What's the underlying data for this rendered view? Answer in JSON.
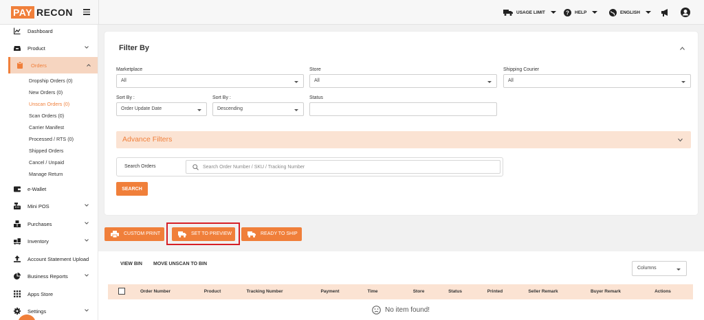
{
  "brand": {
    "part1": "PAY",
    "part2": "RECON",
    "accent": "#f07f3a"
  },
  "topbar": {
    "usage_limit": "USAGE LIMIT",
    "help": "HELP",
    "language": "ENGLISH",
    "icons": [
      "truck-icon",
      "help-circle-icon",
      "globe-icon",
      "megaphone-icon",
      "user-circle-icon"
    ]
  },
  "sidebar": {
    "items": [
      {
        "label": "Dashboard",
        "icon": "chart-line-icon"
      },
      {
        "label": "Product",
        "icon": "inbox-icon"
      },
      {
        "label": "Orders",
        "icon": "clipboard-icon"
      },
      {
        "label": "e-Wallet",
        "icon": "wallet-icon"
      },
      {
        "label": "Mini POS",
        "icon": "cash-register-icon"
      },
      {
        "label": "Purchases",
        "icon": "boxes-icon"
      },
      {
        "label": "Inventory",
        "icon": "pallet-icon"
      },
      {
        "label": "Account Statement Upload",
        "icon": "upload-icon"
      },
      {
        "label": "Business Reports",
        "icon": "pie-chart-icon"
      },
      {
        "label": "Apps Store",
        "icon": "grid-icon"
      },
      {
        "label": "Settings",
        "icon": "gear-icon"
      }
    ],
    "order_subitems": [
      "Dropship Orders (0)",
      "New Orders (0)",
      "Unscan Orders (0)",
      "Scan Orders (0)",
      "Carrier Manifest",
      "Processed / RTS (0)",
      "Shipped Orders",
      "Cancel / Unpaid",
      "Manage Return"
    ]
  },
  "filter": {
    "title": "Filter By",
    "marketplace_label": "Marketplace",
    "marketplace_value": "All",
    "store_label": "Store",
    "store_value": "All",
    "courier_label": "Shipping Courier",
    "courier_value": "All",
    "sortby1_label": "Sort By :",
    "sortby1_value": "Order Update Date",
    "sortby2_label": "Sort By :",
    "sortby2_value": "Descending",
    "status_label": "Status",
    "status_value": ""
  },
  "advance_filters": {
    "label": "Advance Filters"
  },
  "search": {
    "tag": "Search Orders",
    "placeholder": "Search Order Number / SKU / Tracking Number",
    "button": "SEARCH"
  },
  "actions": {
    "custom_print": "CUSTOM PRINT",
    "set_to_preview": "SET TO PREVIEW",
    "ready_to_ship": "READY TO SHIP"
  },
  "bin": {
    "view_bin": "VIEW BIN",
    "move_unscan": "MOVE UNSCAN TO BIN"
  },
  "columns": {
    "label": "Columns"
  },
  "table": {
    "headers": [
      "Order Number",
      "Product",
      "Tracking Number",
      "Payment",
      "Time",
      "Store",
      "Status",
      "Printed",
      "Seller Remark",
      "Buyer Remark",
      "Actions"
    ],
    "empty_text": "No item found!"
  }
}
